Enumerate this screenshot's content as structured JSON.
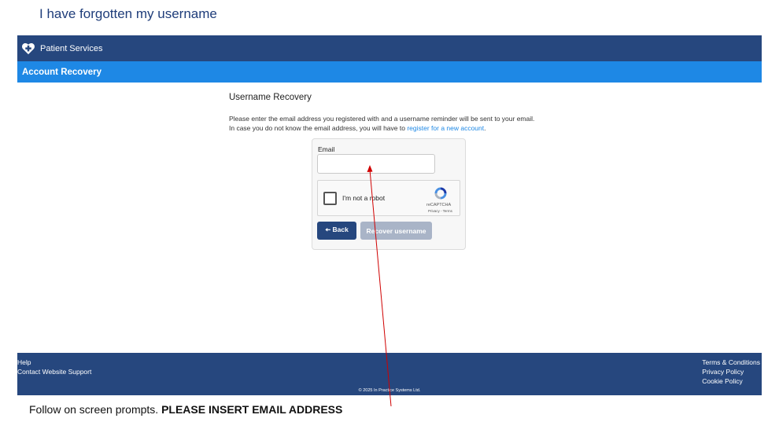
{
  "slide": {
    "title": "I have forgotten my username",
    "instruction_prefix": "Follow on screen prompts.  ",
    "instruction_emphasis": "PLEASE INSERT EMAIL ADDRESS"
  },
  "header": {
    "brand": "Patient Services"
  },
  "subbar": {
    "title": "Account Recovery"
  },
  "content": {
    "heading": "Username Recovery",
    "line1": "Please enter the email address you registered with and a username reminder will be sent to your email.",
    "line2_prefix": "In case you do not know the email address, you will have to ",
    "register_link": "register for a new account",
    "line2_suffix": "."
  },
  "form": {
    "email_label": "Email",
    "email_value": "",
    "captcha_text": "I'm not a robot",
    "captcha_brand": "reCAPTCHA",
    "captcha_terms": "Privacy - Terms",
    "back_label": "Back",
    "recover_label": "Recover username"
  },
  "footer": {
    "left_links": [
      "Help",
      "Contact Website Support"
    ],
    "right_links": [
      "Terms & Conditions",
      "Privacy Policy",
      "Cookie Policy"
    ],
    "copyright": "© 2025 In Practice Systems Ltd."
  },
  "colors": {
    "header": "#26477e",
    "subbar": "#1e88e5",
    "link": "#1e88e5",
    "arrow": "#d00000",
    "button_disabled": "#a9b4c7"
  }
}
